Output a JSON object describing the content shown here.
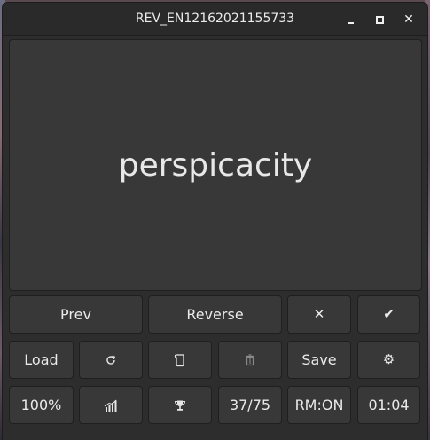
{
  "window": {
    "title": "REV_EN12162021155733",
    "minimize_glyph": "",
    "close_glyph": "✕"
  },
  "card": {
    "word": "perspicacity"
  },
  "row1": {
    "prev_label": "Prev",
    "reverse_label": "Reverse",
    "wrong_glyph": "✕",
    "correct_glyph": "✔"
  },
  "row2": {
    "load_label": "Load",
    "refresh_icon": "refresh-icon",
    "scroll_icon": "scroll-icon",
    "trash_icon": "trash-icon",
    "save_label": "Save",
    "settings_glyph": "⚙"
  },
  "row3": {
    "zoom_label": "100%",
    "stats_icon": "stats-icon",
    "trophy_icon": "trophy-icon",
    "progress_label": "37/75",
    "mode_label": "RM:ON",
    "timer_label": "01:04"
  },
  "colors": {
    "window_bg": "#2d2d2d",
    "button_bg": "#383838",
    "text": "#eaeaea"
  }
}
